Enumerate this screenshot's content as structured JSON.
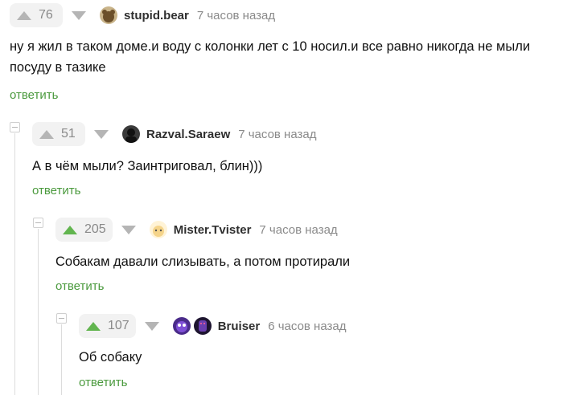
{
  "comments": [
    {
      "score": "76",
      "author": "stupid.bear",
      "time": "7 часов назад",
      "text": "ну я жил в таком доме.и воду с колонки лет с 10 носил.и все равно никогда не мыли посуду в тазике",
      "reply_label": "ответить",
      "up_color": "#b5b5b5"
    },
    {
      "score": "51",
      "author": "Razval.Saraew",
      "time": "7 часов назад",
      "text": "А в чём мыли? Заинтриговал, блин)))",
      "reply_label": "ответить",
      "up_color": "#b5b5b5"
    },
    {
      "score": "205",
      "author": "Mister.Tvister",
      "time": "7 часов назад",
      "text": "Собакам давали слизывать, а потом протирали",
      "reply_label": "ответить",
      "up_color": "#62b54f"
    },
    {
      "score": "107",
      "author": "Bruiser",
      "time": "6 часов назад",
      "text": "Об собаку",
      "reply_label": "ответить",
      "up_color": "#62b54f"
    }
  ],
  "colors": {
    "accent_green": "#4b9a3e",
    "vote_up_active": "#62b54f",
    "muted": "#8a8a8a"
  },
  "icons": {
    "vote_up": "triangle-up",
    "vote_down": "triangle-down",
    "collapse": "minus-square"
  }
}
